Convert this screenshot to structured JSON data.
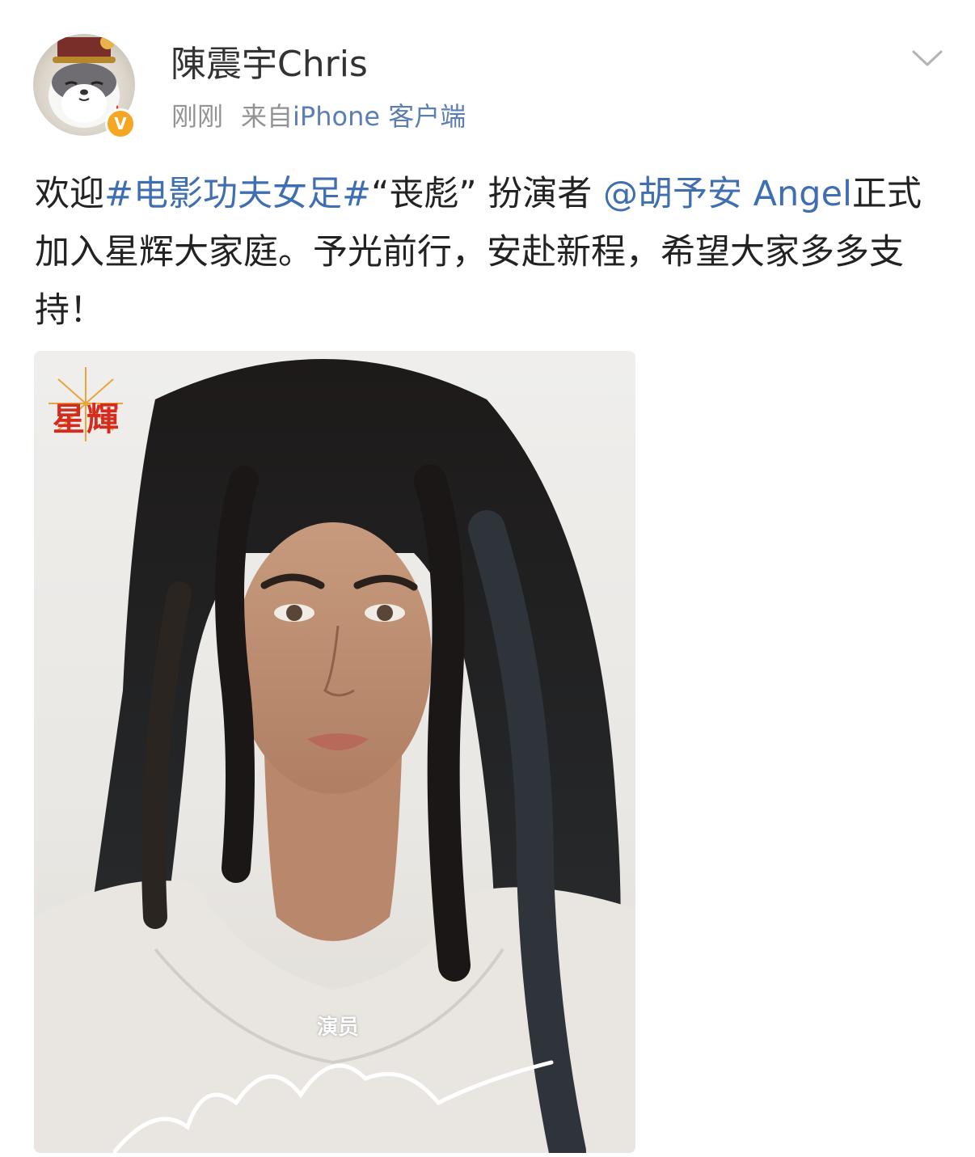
{
  "post": {
    "author_name": "陳震宇Chris",
    "timestamp": "刚刚",
    "source_prefix": "来自",
    "source_client": "iPhone 客户端",
    "text_before_topic": "欢迎",
    "topic": "#电影功夫女足#",
    "text_after_topic": "“丧彪” 扮演者 ",
    "mention": "@胡予安 Angel",
    "text_rest": "正式加入星辉大家庭。予光前行，安赴新程，希望大家多多支持！"
  },
  "poster": {
    "studio_logo": "星輝",
    "role_label": "演员"
  },
  "icons": {
    "avatar": "cat-avatar",
    "badge": "verified-badge-icon",
    "menu": "chevron-down-icon"
  },
  "colors": {
    "link": "#3f6fb0",
    "meta": "#939393",
    "badge": "#f5a623",
    "logo": "#d52b1e"
  }
}
